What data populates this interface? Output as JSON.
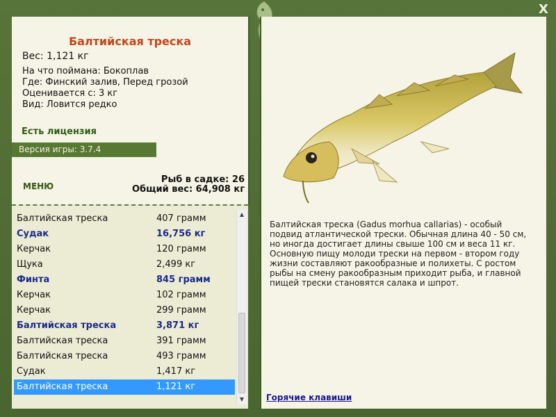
{
  "window": {
    "close_label": "X"
  },
  "fish": {
    "title": "Балтийская треска",
    "weight_label": "Вес: 1,121 кг",
    "caught_on": "На что поймана: Бокоплав",
    "where": "Где: Финский залив, Перед грозой",
    "rated_from": "Оценивается с: 3 кг",
    "kind": "Вид: Ловится редко"
  },
  "license": "Есть лицензия",
  "version": "Версия игры: 3.7.4",
  "menu_label": "МЕНЮ",
  "stats": {
    "fish_in_keepnet": "Рыб в садке: 26",
    "total_weight": "Общий вес: 64,908 кг"
  },
  "catch_list": [
    {
      "name": "Балтийская треска",
      "weight": "407 грамм",
      "big": false,
      "selected": false
    },
    {
      "name": "Судак",
      "weight": "16,756 кг",
      "big": true,
      "selected": false
    },
    {
      "name": "Керчак",
      "weight": "120 грамм",
      "big": false,
      "selected": false
    },
    {
      "name": "Щука",
      "weight": "2,499 кг",
      "big": false,
      "selected": false
    },
    {
      "name": "Финта",
      "weight": "845 грамм",
      "big": true,
      "selected": false
    },
    {
      "name": "Керчак",
      "weight": "102 грамм",
      "big": false,
      "selected": false
    },
    {
      "name": "Керчак",
      "weight": "299 грамм",
      "big": false,
      "selected": false
    },
    {
      "name": "Балтийская треска",
      "weight": "3,871 кг",
      "big": true,
      "selected": false
    },
    {
      "name": "Балтийская треска",
      "weight": "391 грамм",
      "big": false,
      "selected": false
    },
    {
      "name": "Балтийская треска",
      "weight": "493 грамм",
      "big": false,
      "selected": false
    },
    {
      "name": "Судак",
      "weight": "1,417 кг",
      "big": false,
      "selected": false
    },
    {
      "name": "Балтийская треска",
      "weight": "1,121 кг",
      "big": false,
      "selected": true
    }
  ],
  "scrollbar": {
    "up_icon": "arrow-up-icon",
    "down_icon": "arrow-down-icon"
  },
  "description": "Балтийская треска (Gadus morhua callarias) - особый подвид атлантической трески. Обычная длина 40 - 50 см, но иногда достигает длины свыше 100 см и веса 11 кг. Основную пищу молоди трески на первом - втором году жизни составляют ракообразные и полихеты. С ростом рыбы на смену ракообразным приходит рыба, и главной пищей трески становятся салака и шпрот.",
  "hotkeys_label": "Горячие клавиши",
  "colors": {
    "title": "#c0471c",
    "big_fish": "#1a2a8a",
    "selected": "#3399ff",
    "frame": "#4e6b33"
  }
}
